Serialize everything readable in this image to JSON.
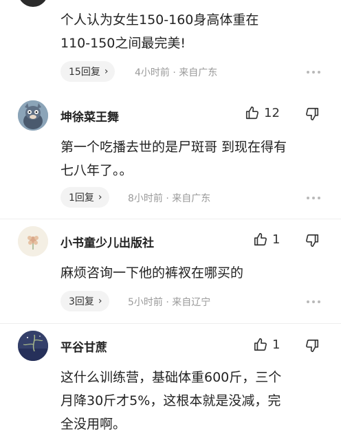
{
  "comments": [
    {
      "content_lines": [
        "个人认为女生150-160身高体重在",
        "110-150之间最完美!"
      ],
      "reply_label": "15回复",
      "meta": "4小时前 · 来自广东"
    },
    {
      "username": "坤徐菜王舞",
      "likes": "12",
      "content_lines": [
        "第一个吃播去世的是尸斑哥 到现在得有",
        "七八年了。。"
      ],
      "reply_label": "1回复",
      "meta": "8小时前 · 来自广东"
    },
    {
      "username": "小书童少儿出版社",
      "likes": "1",
      "content_lines": [
        "麻烦咨询一下他的裤衩在哪买的"
      ],
      "reply_label": "3回复",
      "meta": "5小时前 · 来自辽宁"
    },
    {
      "username": "平谷甘蔗",
      "likes": "1",
      "content_lines": [
        "这什么训练营，基础体重600斤，三个",
        "月降30斤才5%，这根本就是没减，完",
        "全没用啊。"
      ]
    }
  ],
  "icons": {
    "like": "thumbs-up-icon",
    "dislike": "thumbs-down-icon",
    "more": "more-dots-icon",
    "chevron": "chevron-right-icon"
  }
}
